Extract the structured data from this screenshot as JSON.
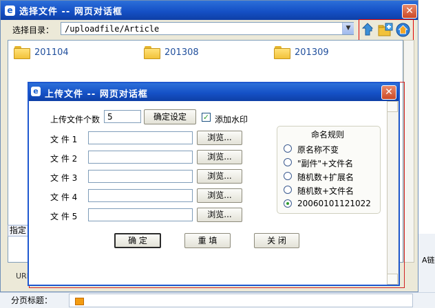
{
  "outer_dialog": {
    "title": "选择文件 -- 网页对话框",
    "close_glyph": "✕",
    "title_icon_glyph": "e",
    "directory_label": "选择目录：",
    "directory_value": "/uploadfile/Article",
    "select_arrow": "▼",
    "folders": [
      {
        "name": "201104"
      },
      {
        "name": "201308"
      },
      {
        "name": "201309"
      }
    ],
    "left_tab_text": "指定",
    "left_url_text": "URL",
    "right_label": "A链",
    "bottom_label": "分页标题："
  },
  "upload_dialog": {
    "title": "上传文件 -- 网页对话框",
    "close_glyph": "✕",
    "title_icon_glyph": "e",
    "count_label": "上传文件个数",
    "count_value": "5",
    "confirm_setting_label": "确定设定",
    "watermark_checked": true,
    "watermark_check_glyph": "✓",
    "watermark_label": "添加水印",
    "files": [
      {
        "label": "文 件 1",
        "value": "",
        "browse_label": "浏览..."
      },
      {
        "label": "文 件 2",
        "value": "",
        "browse_label": "浏览..."
      },
      {
        "label": "文 件 3",
        "value": "",
        "browse_label": "浏览..."
      },
      {
        "label": "文 件 4",
        "value": "",
        "browse_label": "浏览..."
      },
      {
        "label": "文 件 5",
        "value": "",
        "browse_label": "浏览..."
      }
    ],
    "naming_rules": {
      "title": "命名规则",
      "options": [
        {
          "label": "原名称不变",
          "selected": false
        },
        {
          "label": "\"副件\"+文件名",
          "selected": false
        },
        {
          "label": "随机数+扩展名",
          "selected": false
        },
        {
          "label": "随机数+文件名",
          "selected": false
        },
        {
          "label": "20060101121022",
          "selected": true
        }
      ]
    },
    "ok_label": "确 定",
    "reset_label": "重 填",
    "close_label": "关 闭"
  },
  "colors": {
    "titlebar": "#1551c6",
    "dialog_bg": "#ece9d8",
    "highlight_border": "#e00000",
    "folder_text": "#1f4e9c"
  },
  "icons": [
    "up-folder-icon",
    "new-folder-icon",
    "home-icon",
    "folder-icon",
    "ie-icon",
    "close-icon"
  ]
}
